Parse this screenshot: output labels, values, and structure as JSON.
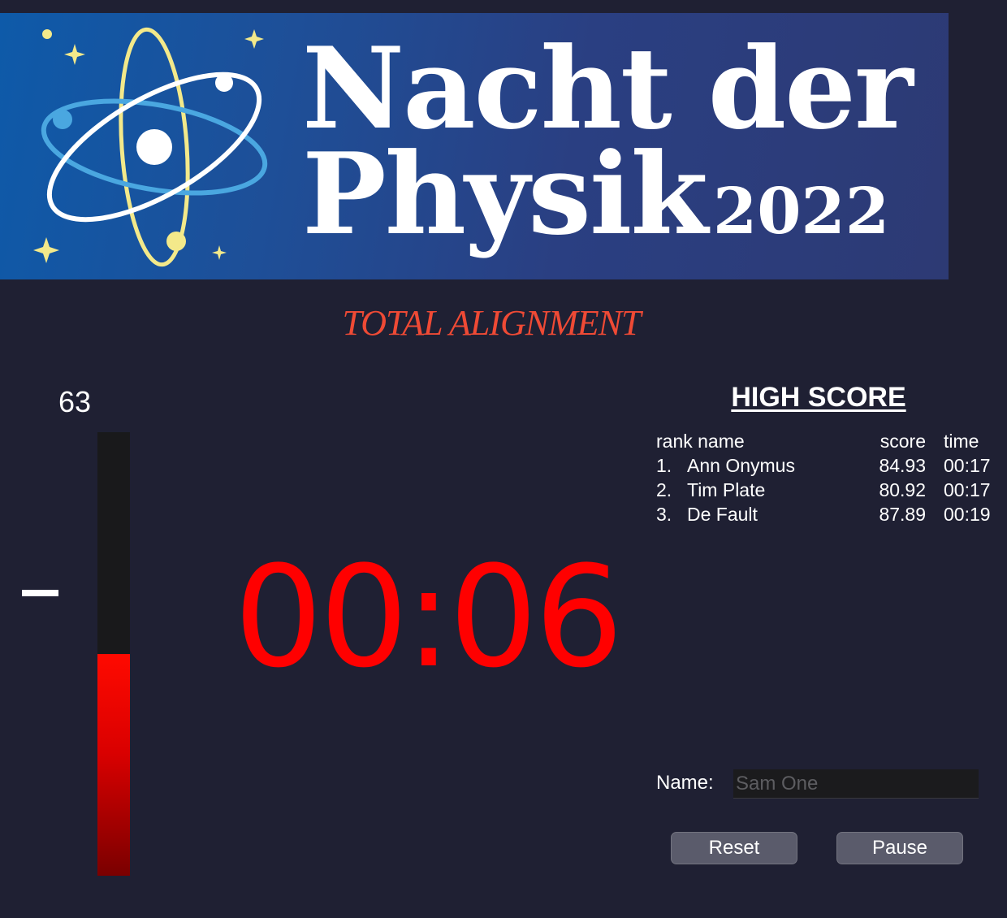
{
  "banner": {
    "title_line1": "Nacht der",
    "title_line2": "Physik",
    "year": "2022"
  },
  "game_title": "TOTAL ALIGNMENT",
  "meter": {
    "value": "63",
    "level_fraction": 0.5
  },
  "timer": "00:06",
  "high_score": {
    "title": "HIGH SCORE",
    "headers": {
      "rank_name": "rank name",
      "score": "score",
      "time": "time"
    },
    "rows": [
      {
        "rank": "1.",
        "name": "Ann Onymus",
        "score": "84.93",
        "time": "00:17"
      },
      {
        "rank": "2.",
        "name": "Tim Plate",
        "score": "80.92",
        "time": "00:17"
      },
      {
        "rank": "3.",
        "name": "De Fault",
        "score": "87.89",
        "time": "00:19"
      }
    ]
  },
  "name_field": {
    "label": "Name:",
    "placeholder": "Sam One",
    "value": ""
  },
  "buttons": {
    "reset": "Reset",
    "pause": "Pause"
  },
  "colors": {
    "background": "#1f2033",
    "accent_red": "#ff0000",
    "title_red": "#ef4a35"
  }
}
